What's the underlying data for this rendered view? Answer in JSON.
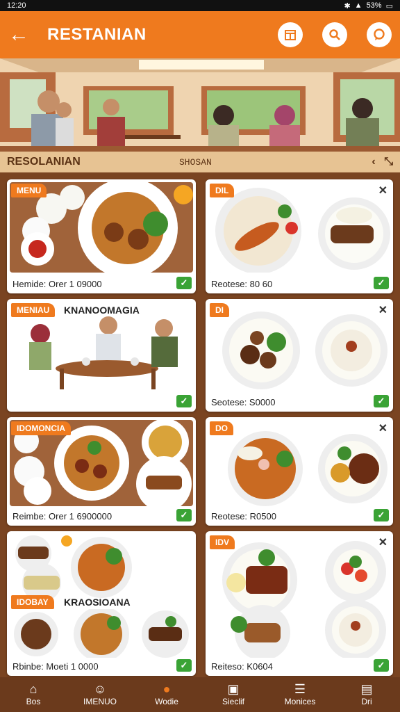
{
  "status": {
    "time": "12:20",
    "battery": "53%"
  },
  "appbar": {
    "title": "RESTANIAN",
    "back_icon": "arrow-left-icon"
  },
  "subbar": {
    "left": "RESOLANIAN",
    "mid": "SHOSAN"
  },
  "cards": [
    {
      "tag": "MENU",
      "caption": "Hemide: Orer 1 09000",
      "close": false
    },
    {
      "tag": "DIL",
      "caption": "Reotese: 80 60",
      "close": true
    },
    {
      "tag": "MENIAU",
      "subhead": "KNANOOMAGIA",
      "caption": "",
      "close": false
    },
    {
      "tag": "DI",
      "caption": "Seotese: S0000",
      "close": true
    },
    {
      "tag": "IDOMONCIA",
      "caption": "Reimbe: Orer 1 6900000",
      "close": false
    },
    {
      "tag": "DO",
      "caption": "Reotese: R0500",
      "close": true
    },
    {
      "tag": "IDOBAY",
      "subhead": "KRAOSIOANA",
      "caption": "Rbinbe: Moeti 1 0000",
      "close": false
    },
    {
      "tag": "IDV",
      "caption": "Reiteso: K0604",
      "close": true
    }
  ],
  "nav": [
    {
      "label": "Bos",
      "icon": "home-icon"
    },
    {
      "label": "IMENUO",
      "icon": "user-icon"
    },
    {
      "label": "Wodie",
      "icon": "fire-icon"
    },
    {
      "label": "Sieclif",
      "icon": "cart-icon"
    },
    {
      "label": "Monices",
      "icon": "list-icon"
    },
    {
      "label": "Dri",
      "icon": "doc-icon"
    }
  ]
}
